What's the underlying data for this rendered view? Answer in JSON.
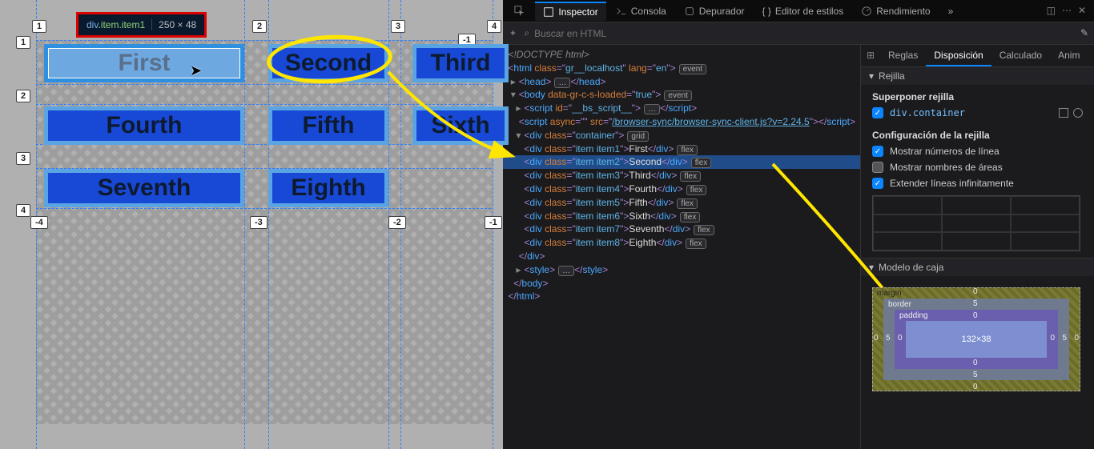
{
  "viewport": {
    "tooltip_selector_tag": "div",
    "tooltip_selector_cls1": ".item",
    "tooltip_selector_cls2": ".item1",
    "tooltip_dims": "250 × 48",
    "items": [
      "First",
      "Second",
      "Third",
      "Fourth",
      "Fifth",
      "Sixth",
      "Seventh",
      "Eighth"
    ],
    "col_lines_top": [
      "1",
      "2",
      "3",
      "4"
    ],
    "col_lines_bottom": [
      "-4",
      "-3",
      "-2",
      "-1"
    ],
    "row_lines_left": [
      "1",
      "2",
      "3",
      "4"
    ],
    "row_lines_right": [
      "-1"
    ]
  },
  "tabs": {
    "inspector": "Inspector",
    "console": "Consola",
    "debugger": "Depurador",
    "styleeditor": "Editor de estilos",
    "performance": "Rendimiento"
  },
  "search_placeholder": "Buscar en HTML",
  "markup": {
    "doctype": "<!DOCTYPE html>",
    "html_attrs": {
      "class": "gr__localhost",
      "lang": "en"
    },
    "body_attr": "data-gr-c-s-loaded",
    "body_val": "true",
    "script_id": "__bs_script__",
    "script_src": "/browser-sync/browser-sync-client.js?v=2.24.5",
    "container_class": "container",
    "items": [
      {
        "cls": "item item1",
        "txt": "First"
      },
      {
        "cls": "item item2",
        "txt": "Second"
      },
      {
        "cls": "item item3",
        "txt": "Third"
      },
      {
        "cls": "item item4",
        "txt": "Fourth"
      },
      {
        "cls": "item item5",
        "txt": "Fifth"
      },
      {
        "cls": "item item6",
        "txt": "Sixth"
      },
      {
        "cls": "item item7",
        "txt": "Seventh"
      },
      {
        "cls": "item item8",
        "txt": "Eighth"
      }
    ],
    "badge_event": "event",
    "badge_flex": "flex",
    "badge_grid": "grid",
    "ellipsis": "…"
  },
  "sidebar": {
    "subtabs": {
      "rules": "Reglas",
      "layout": "Disposición",
      "computed": "Calculado",
      "anim": "Anim"
    },
    "grid_head": "Rejilla",
    "overlay_label": "Superponer rejilla",
    "overlay_selector": "div.container",
    "settings_label": "Configuración de la rejilla",
    "opt_linenums": "Mostrar números de línea",
    "opt_areanames": "Mostrar nombres de áreas",
    "opt_extend": "Extender líneas infinitamente",
    "boxmodel_head": "Modelo de caja",
    "bm": {
      "margin": "margin",
      "border": "border",
      "padding": "padding",
      "content": "132×38",
      "m_t": "0",
      "m_r": "0",
      "m_b": "0",
      "m_l": "0",
      "b_t": "5",
      "b_r": "5",
      "b_b": "5",
      "b_l": "5",
      "p_t": "0",
      "p_r": "0",
      "p_b": "0",
      "p_l": "0"
    }
  }
}
